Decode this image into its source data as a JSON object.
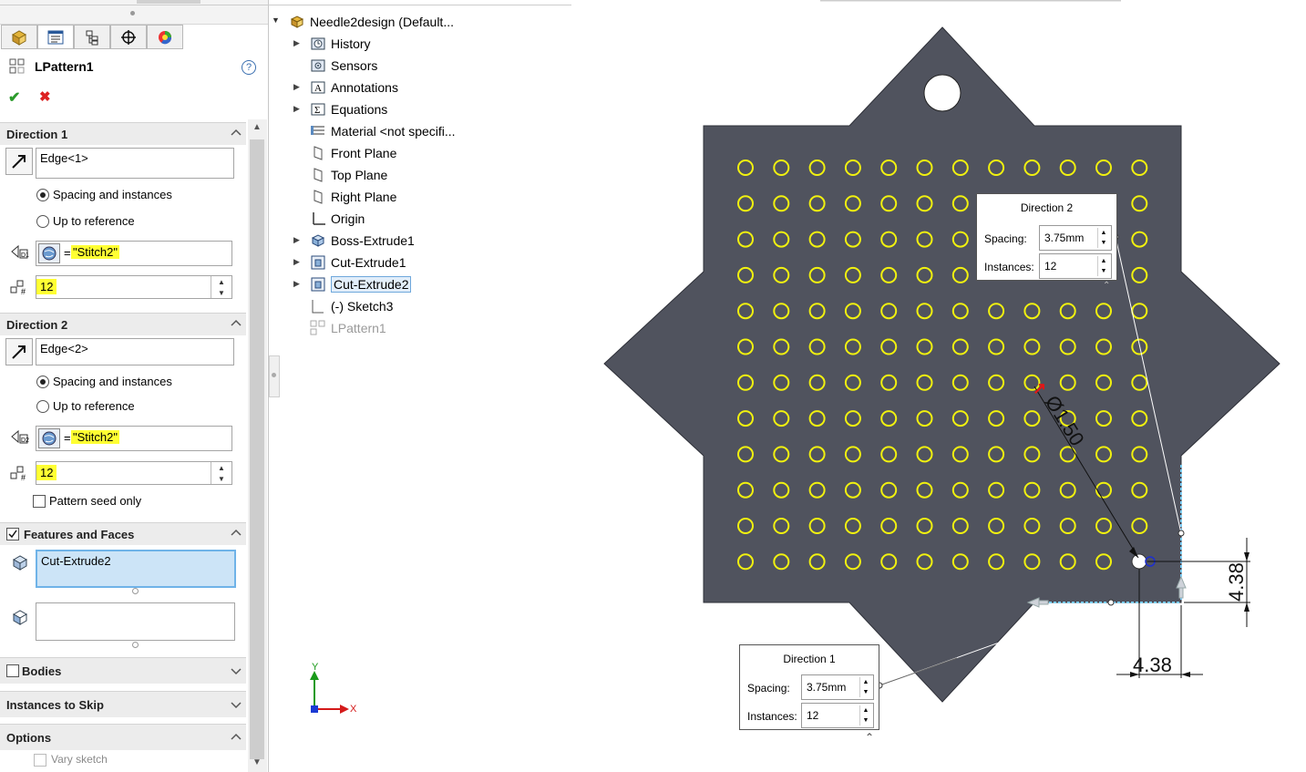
{
  "property_manager": {
    "feature_name": "LPattern1",
    "tabs": [
      "feature-manager-icon",
      "property-manager-icon",
      "configuration-manager-icon",
      "dimxpert-icon",
      "display-manager-icon"
    ],
    "direction1": {
      "header": "Direction 1",
      "edge": "Edge<1>",
      "option_spacing": "Spacing and instances",
      "option_up_to": "Up to reference",
      "spacing_eq": "=",
      "spacing_value": "\"Stitch2\"",
      "instances": "12"
    },
    "direction2": {
      "header": "Direction 2",
      "edge": "Edge<2>",
      "option_spacing": "Spacing and instances",
      "option_up_to": "Up to reference",
      "spacing_eq": "=",
      "spacing_value": "\"Stitch2\"",
      "instances": "12",
      "seed_only": "Pattern seed only"
    },
    "features": {
      "header": "Features and Faces",
      "feature_item": "Cut-Extrude2"
    },
    "bodies": {
      "header": "Bodies"
    },
    "skip": {
      "header": "Instances to Skip"
    },
    "options": {
      "header": "Options",
      "vary_sketch": "Vary sketch"
    }
  },
  "tree": {
    "root": "Needle2design  (Default...",
    "items": [
      {
        "label": "History",
        "icon": "history-icon",
        "expandable": true
      },
      {
        "label": "Sensors",
        "icon": "sensors-icon",
        "expandable": false
      },
      {
        "label": "Annotations",
        "icon": "annotations-icon",
        "expandable": true
      },
      {
        "label": "Equations",
        "icon": "equations-icon",
        "expandable": true
      },
      {
        "label": "Material <not specifi...",
        "icon": "material-icon",
        "expandable": false
      },
      {
        "label": "Front Plane",
        "icon": "plane-icon",
        "expandable": false
      },
      {
        "label": "Top Plane",
        "icon": "plane-icon",
        "expandable": false
      },
      {
        "label": "Right Plane",
        "icon": "plane-icon",
        "expandable": false
      },
      {
        "label": "Origin",
        "icon": "origin-icon",
        "expandable": false
      },
      {
        "label": "Boss-Extrude1",
        "icon": "extrude-icon",
        "expandable": true
      },
      {
        "label": "Cut-Extrude1",
        "icon": "cut-icon",
        "expandable": true
      },
      {
        "label": "Cut-Extrude2",
        "icon": "cut-icon",
        "expandable": true
      },
      {
        "label": "(-) Sketch3",
        "icon": "sketch-icon",
        "expandable": false
      },
      {
        "label": "LPattern1",
        "icon": "pattern-icon",
        "expandable": false
      }
    ]
  },
  "viewport": {
    "direction2_callout": {
      "title": "Direction 2",
      "spacing_label": "Spacing:",
      "spacing": "3.75mm",
      "instances_label": "Instances:",
      "instances": "12"
    },
    "direction1_callout": {
      "title": "Direction 1",
      "spacing_label": "Spacing:",
      "spacing": "3.75mm",
      "instances_label": "Instances:",
      "instances": "12"
    },
    "dim_diameter": "Ø1.50",
    "dim_vertical": "4.38",
    "dim_horizontal": "4.38",
    "axis_x": "X",
    "axis_y": "Y",
    "colors": {
      "part": "#50535e",
      "holes": "#f1f10f",
      "highlight": "#ffff33"
    }
  }
}
